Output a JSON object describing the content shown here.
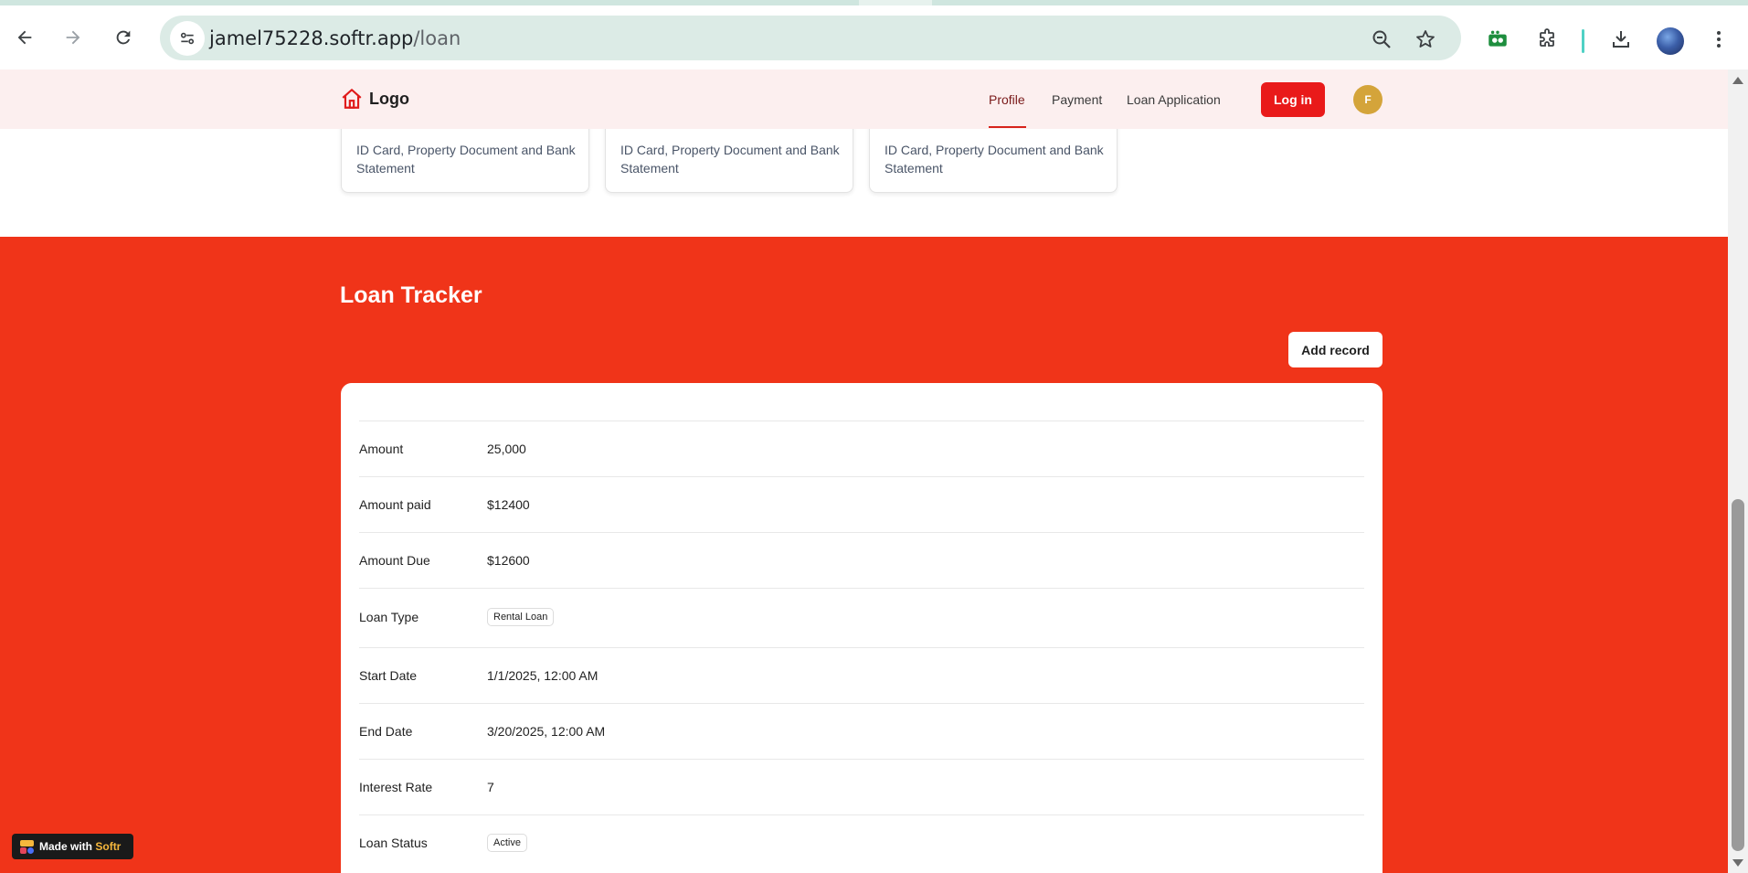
{
  "browser": {
    "url_host": "jamel75228.softr.app",
    "url_path": "/loan"
  },
  "header": {
    "logo_text": "Logo",
    "nav": [
      "Profile",
      "Payment",
      "Loan Application"
    ],
    "active_nav": "Profile",
    "login_label": "Log in",
    "avatar_initial": "F"
  },
  "documents": {
    "cards": [
      "ID Card, Property Document and Bank Statement",
      "ID Card, Property Document and Bank Statement",
      "ID Card, Property Document and Bank Statement"
    ]
  },
  "tracker": {
    "title": "Loan Tracker",
    "add_record_label": "Add record",
    "fields": [
      {
        "label": "Amount",
        "value": "25,000"
      },
      {
        "label": "Amount paid",
        "value": "$12400"
      },
      {
        "label": "Amount Due",
        "value": "$12600"
      },
      {
        "label": "Loan Type",
        "tag": "Rental Loan"
      },
      {
        "label": "Start Date",
        "value": "1/1/2025, 12:00 AM"
      },
      {
        "label": "End Date",
        "value": "3/20/2025, 12:00 AM"
      },
      {
        "label": "Interest Rate",
        "value": "7"
      },
      {
        "label": "Loan Status",
        "tag": "Active"
      }
    ]
  },
  "badge": {
    "prefix": "Made with",
    "brand": "Softr"
  },
  "colors": {
    "brand_red": "#f03419",
    "login_red": "#e91a1a",
    "header_bg": "#fcefef",
    "avatar_gold": "#d4a43a"
  }
}
